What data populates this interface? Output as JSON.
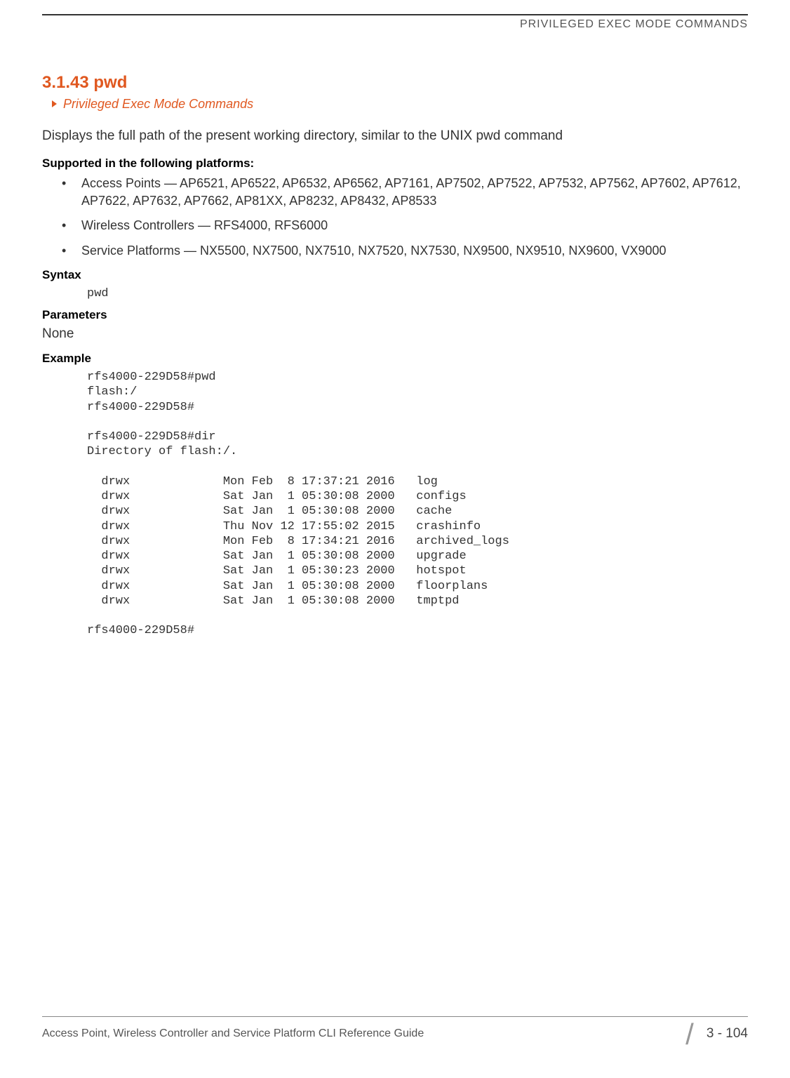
{
  "header": {
    "title": "PRIVILEGED EXEC MODE COMMANDS"
  },
  "section": {
    "number_title": "3.1.43 pwd",
    "breadcrumb": "Privileged Exec Mode Commands",
    "description": "Displays the full path of the present working directory, similar to the UNIX pwd command"
  },
  "supported": {
    "label": "Supported in the following platforms:",
    "items": [
      "Access Points — AP6521, AP6522, AP6532, AP6562, AP7161, AP7502, AP7522, AP7532, AP7562, AP7602, AP7612, AP7622, AP7632, AP7662, AP81XX, AP8232, AP8432, AP8533",
      "Wireless Controllers — RFS4000, RFS6000",
      "Service Platforms — NX5500, NX7500, NX7510, NX7520, NX7530, NX9500, NX9510, NX9600, VX9000"
    ]
  },
  "syntax": {
    "label": "Syntax",
    "code": "pwd"
  },
  "parameters": {
    "label": "Parameters",
    "value": "None"
  },
  "example": {
    "label": "Example",
    "code": "rfs4000-229D58#pwd\nflash:/\nrfs4000-229D58#\n\nrfs4000-229D58#dir\nDirectory of flash:/.\n\n  drwx             Mon Feb  8 17:37:21 2016   log\n  drwx             Sat Jan  1 05:30:08 2000   configs\n  drwx             Sat Jan  1 05:30:08 2000   cache\n  drwx             Thu Nov 12 17:55:02 2015   crashinfo\n  drwx             Mon Feb  8 17:34:21 2016   archived_logs\n  drwx             Sat Jan  1 05:30:08 2000   upgrade\n  drwx             Sat Jan  1 05:30:23 2000   hotspot\n  drwx             Sat Jan  1 05:30:08 2000   floorplans\n  drwx             Sat Jan  1 05:30:08 2000   tmptpd\n\nrfs4000-229D58#"
  },
  "footer": {
    "left": "Access Point, Wireless Controller and Service Platform CLI Reference Guide",
    "page": "3 - 104"
  }
}
